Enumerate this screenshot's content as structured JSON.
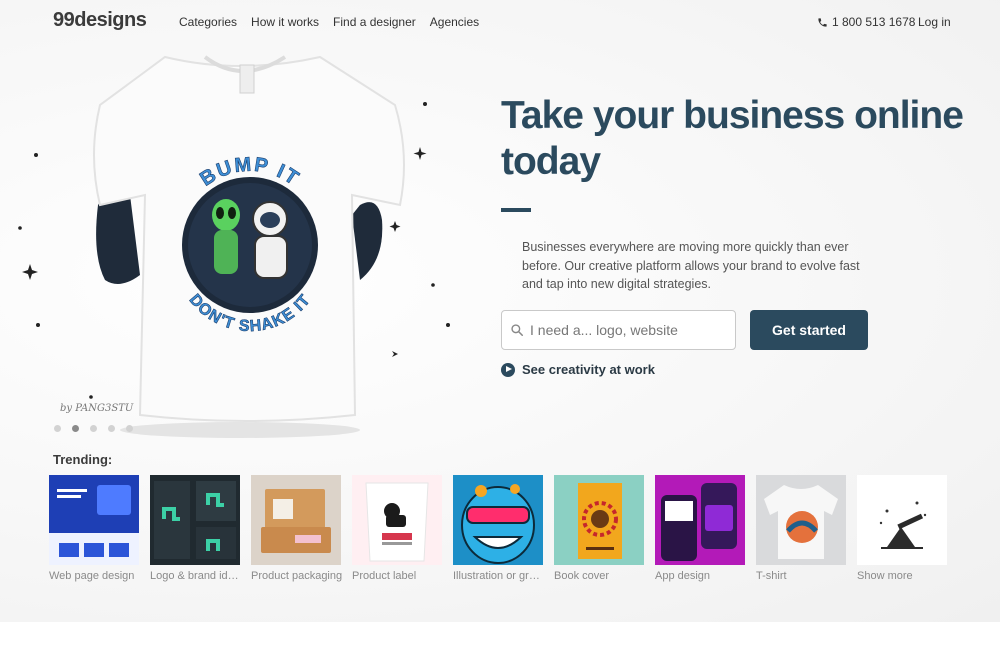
{
  "header": {
    "logo": "99designs",
    "nav": [
      "Categories",
      "How it works",
      "Find a designer",
      "Agencies"
    ],
    "phone": "1 800 513 1678",
    "login": "Log in"
  },
  "hero": {
    "shirt_text_top": "BUMP IT",
    "shirt_text_bottom": "DON'T SHAKE IT",
    "byline": "by PANG3STU",
    "carousel_active_index": 1,
    "carousel_count": 5,
    "headline": "Take your business online today",
    "description": "Businesses everywhere are moving more quickly than ever before. Our creative platform allows your brand to evolve fast and tap into new digital strategies.",
    "search_placeholder": "I need a... logo, website",
    "cta": "Get started",
    "see_creativity": "See creativity at work"
  },
  "trending": {
    "title": "Trending:",
    "items": [
      {
        "label": "Web page design",
        "icon": "web-page-thumb"
      },
      {
        "label": "Logo & brand identity",
        "icon": "logo-brand-thumb"
      },
      {
        "label": "Product packaging",
        "icon": "product-packaging-thumb"
      },
      {
        "label": "Product label",
        "icon": "product-label-thumb"
      },
      {
        "label": "Illustration or graphics",
        "icon": "illustration-thumb"
      },
      {
        "label": "Book cover",
        "icon": "book-cover-thumb"
      },
      {
        "label": "App design",
        "icon": "app-design-thumb"
      },
      {
        "label": "T-shirt",
        "icon": "tshirt-thumb"
      },
      {
        "label": "Show more",
        "icon": "show-more-thumb"
      }
    ]
  },
  "colors": {
    "brand_dark": "#2b4a5e",
    "text_muted": "#8a8a8a"
  }
}
